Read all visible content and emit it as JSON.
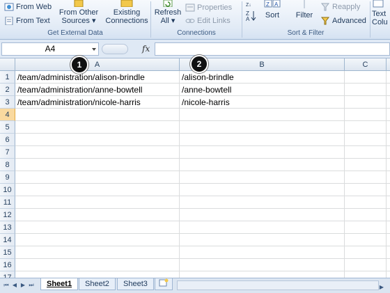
{
  "ribbon": {
    "get_external_data": {
      "from_web": "From Web",
      "from_text": "From Text",
      "from_other_sources_line1": "From Other",
      "from_other_sources_line2": "Sources ▾",
      "existing_line1": "Existing",
      "existing_line2": "Connections",
      "label": "Get External Data"
    },
    "connections": {
      "refresh_line1": "Refresh",
      "refresh_line2": "All ▾",
      "properties": "Properties",
      "edit_links": "Edit Links",
      "label": "Connections"
    },
    "sort_filter": {
      "sort": "Sort",
      "filter": "Filter",
      "reapply": "Reapply",
      "advanced": "Advanced",
      "label": "Sort & Filter"
    },
    "data_tools": {
      "text_line1": "Text",
      "text_line2": "Colu"
    }
  },
  "formula_bar": {
    "name_box": "A4",
    "fx": "fx",
    "content": ""
  },
  "grid": {
    "columns": [
      "A",
      "B",
      "C"
    ],
    "rows": [
      "1",
      "2",
      "3",
      "4",
      "5",
      "6",
      "7",
      "8",
      "9",
      "10",
      "11",
      "12",
      "13",
      "14",
      "15",
      "16",
      "17"
    ],
    "cells": {
      "A1": "/team/administration/alison-brindle",
      "A2": "/team/administration/anne-bowtell",
      "A3": "/team/administration/nicole-harris",
      "B1": "/alison-brindle",
      "B2": "/anne-bowtell",
      "B3": "/nicole-harris"
    },
    "callouts": [
      "1",
      "2"
    ]
  },
  "sheets": {
    "tabs": [
      "Sheet1",
      "Sheet2",
      "Sheet3"
    ],
    "active": "Sheet1"
  }
}
